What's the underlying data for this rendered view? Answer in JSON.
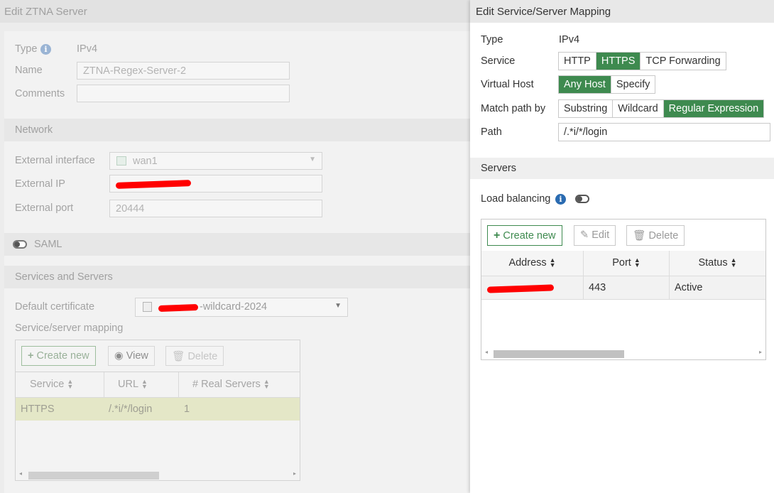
{
  "background_dialog": {
    "title": "Edit ZTNA Server",
    "type_label": "Type",
    "type_value": "IPv4",
    "name_label": "Name",
    "name_value": "ZTNA-Regex-Server-2",
    "comments_label": "Comments",
    "comments_value": "",
    "network_section": "Network",
    "external_interface_label": "External interface",
    "external_interface_value": "wan1",
    "external_ip_label": "External IP",
    "external_port_label": "External port",
    "external_port_value": "20444",
    "saml_label": "SAML",
    "services_section": "Services and Servers",
    "default_certificate_label": "Default certificate",
    "default_certificate_value": "-wildcard-2024",
    "mapping_label": "Service/server mapping",
    "toolbar": {
      "create_new": "Create new",
      "view": "View",
      "delete": "Delete"
    },
    "table": {
      "columns": [
        "Service",
        "URL",
        "# Real Servers"
      ],
      "rows": [
        {
          "service": "HTTPS",
          "url": "/.*i/*/login",
          "real_servers": "1"
        }
      ]
    }
  },
  "mapping_dialog": {
    "title": "Edit Service/Server Mapping",
    "type_label": "Type",
    "type_value": "IPv4",
    "service_label": "Service",
    "service_options": [
      "HTTP",
      "HTTPS",
      "TCP Forwarding"
    ],
    "service_selected": "HTTPS",
    "virtual_host_label": "Virtual Host",
    "virtual_host_options": [
      "Any Host",
      "Specify"
    ],
    "virtual_host_selected": "Any Host",
    "match_path_label": "Match path by",
    "match_path_options": [
      "Substring",
      "Wildcard",
      "Regular Expression"
    ],
    "match_path_selected": "Regular Expression",
    "path_label": "Path",
    "path_value": "/.*i/*/login",
    "servers_section": "Servers",
    "load_balancing_label": "Load balancing",
    "load_balancing_enabled": false,
    "toolbar": {
      "create_new": "Create new",
      "edit": "Edit",
      "delete": "Delete"
    },
    "table": {
      "columns": [
        "Address",
        "Port",
        "Status"
      ],
      "rows": [
        {
          "address": "",
          "port": "443",
          "status": "Active"
        }
      ]
    }
  },
  "colors": {
    "accent_green": "#3e8a4f",
    "redaction": "#ff0000",
    "info_blue": "#2a6bb1"
  }
}
